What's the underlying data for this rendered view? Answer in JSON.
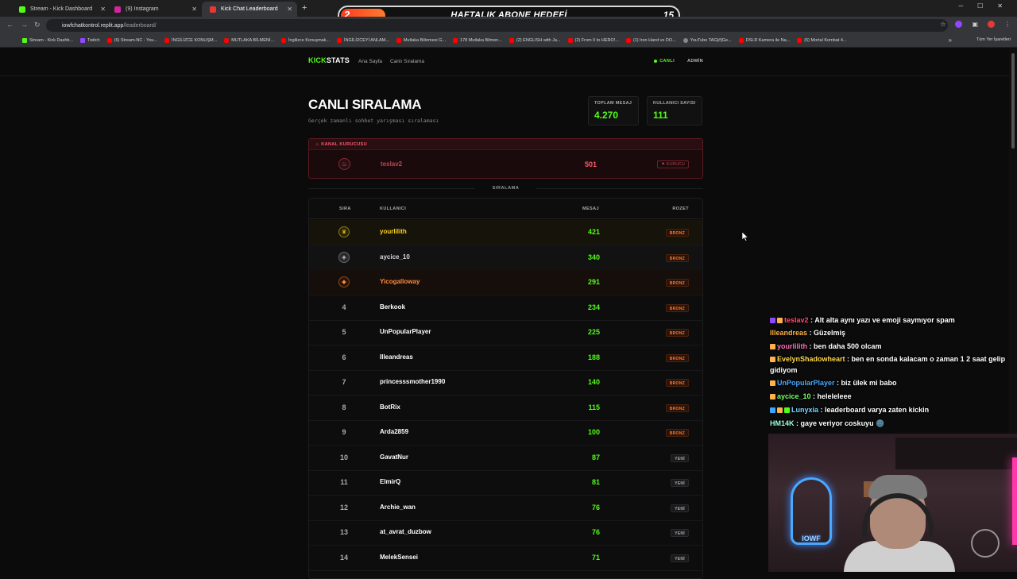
{
  "browser": {
    "tabs": [
      {
        "label": "Stream - Kick Dashboard",
        "color": "#53fc18"
      },
      {
        "label": "(9) Instagram",
        "color": "#d6249f"
      },
      {
        "label": "Kick Chat Leaderboard",
        "color": "#e53935"
      }
    ],
    "url_host": "iowfchatkontrol.replit.app",
    "url_path": "/leaderboard/",
    "bookmarks": [
      {
        "label": "Stream - Kick Dashb...",
        "icon": "k"
      },
      {
        "label": "Twitch",
        "icon": "tw"
      },
      {
        "label": "(6) Stream-NC - You...",
        "icon": "yt"
      },
      {
        "label": "İNGİLİZCE KONUŞM...",
        "icon": "yt"
      },
      {
        "label": "MUTLAKA BİLMENİ...",
        "icon": "yt"
      },
      {
        "label": "İngilizce Konuşmak...",
        "icon": "yt"
      },
      {
        "label": "İNGİLİZCEYİ ANLAM...",
        "icon": "yt"
      },
      {
        "label": "Mutlaka Bilinmesi G...",
        "icon": "yt"
      },
      {
        "label": "178 Mutlaka Bilmen...",
        "icon": "yt"
      },
      {
        "label": "(2) ENGLISH with Ja...",
        "icon": "yt"
      },
      {
        "label": "(2) From 0 to HERO!...",
        "icon": "yt"
      },
      {
        "label": "(1) Iron Hand vs DO...",
        "icon": "yt"
      },
      {
        "label": "YouTube TAG[#]Ge...",
        "icon": "g"
      },
      {
        "label": "DSLR Kamera ile Na...",
        "icon": "yt"
      },
      {
        "label": "(5) Mortal Kombat 4...",
        "icon": "yt"
      }
    ],
    "bookmarks_right": "Tüm Yer İşaretleri"
  },
  "goal": {
    "current": "2",
    "label": "HAFTALIK ABONE HEDEFİ",
    "target": "15",
    "progress": 0.13
  },
  "nav": {
    "logo_a": "KICK",
    "logo_b": "STATS",
    "links": [
      "Ana Sayfa",
      "Canlı Sıralama"
    ],
    "live": "CANLI",
    "admin": "ADMİN"
  },
  "header": {
    "title": "CANLI SIRALAMA",
    "subtitle": "Gerçek zamanlı sohbet yarışması sıralaması"
  },
  "stats": [
    {
      "label": "TOPLAM MESAJ",
      "value": "4.270"
    },
    {
      "label": "KULLANICI SAYISI",
      "value": "111"
    }
  ],
  "founder": {
    "header": "KANAL KURUCUSU",
    "name": "teslav2",
    "count": "501",
    "badge": "KURUCU"
  },
  "section_title": "SIRALAMA",
  "table": {
    "headers": {
      "rank": "SIRA",
      "user": "KULLANICI",
      "messages": "MESAJ",
      "badge": "ROZET"
    },
    "rows": [
      {
        "rank": "1",
        "medal": "g",
        "name": "yourlilith",
        "count": "421",
        "badge": "BRONZ"
      },
      {
        "rank": "2",
        "medal": "s",
        "name": "aycice_10",
        "count": "340",
        "badge": "BRONZ"
      },
      {
        "rank": "3",
        "medal": "b",
        "name": "Yicogalloway",
        "count": "291",
        "badge": "BRONZ"
      },
      {
        "rank": "4",
        "medal": "",
        "name": "Berkook",
        "count": "234",
        "badge": "BRONZ"
      },
      {
        "rank": "5",
        "medal": "",
        "name": "UnPopularPlayer",
        "count": "225",
        "badge": "BRONZ"
      },
      {
        "rank": "6",
        "medal": "",
        "name": "Illeandreas",
        "count": "188",
        "badge": "BRONZ"
      },
      {
        "rank": "7",
        "medal": "",
        "name": "princesssmother1990",
        "count": "140",
        "badge": "BRONZ"
      },
      {
        "rank": "8",
        "medal": "",
        "name": "BotRix",
        "count": "115",
        "badge": "BRONZ"
      },
      {
        "rank": "9",
        "medal": "",
        "name": "Arda2859",
        "count": "100",
        "badge": "BRONZ"
      },
      {
        "rank": "10",
        "medal": "",
        "name": "GavatNur",
        "count": "87",
        "badge": "YENİ"
      },
      {
        "rank": "11",
        "medal": "",
        "name": "ElmirQ",
        "count": "81",
        "badge": "YENİ"
      },
      {
        "rank": "12",
        "medal": "",
        "name": "Archie_wan",
        "count": "76",
        "badge": "YENİ"
      },
      {
        "rank": "13",
        "medal": "",
        "name": "at_avrat_duzbow",
        "count": "76",
        "badge": "YENİ"
      },
      {
        "rank": "14",
        "medal": "",
        "name": "MelekSensei",
        "count": "71",
        "badge": "YENİ"
      }
    ]
  },
  "chat": [
    {
      "user": "teslav2",
      "color": "#ff4d6a",
      "icons": [
        "#9146ff",
        "#ffb14d"
      ],
      "text": "Alt alta aynı yazı ve emoji saymıyor spam"
    },
    {
      "user": "Illeandreas",
      "color": "#ffb347",
      "icons": [],
      "text": "Güzelmiş"
    },
    {
      "user": "yourlilith",
      "color": "#ff6fb5",
      "icons": [
        "#ffb14d"
      ],
      "text": "ben daha 500 olcam"
    },
    {
      "user": "EvelynShadowheart",
      "color": "#ffd94d",
      "icons": [
        "#ffb14d"
      ],
      "text": "ben en sonda kalacam o zaman 1 2 saat gelip gidiyom"
    },
    {
      "user": "UnPopularPlayer",
      "color": "#4aa8ff",
      "icons": [
        "#ffb14d"
      ],
      "text": "biz ülek mi babo"
    },
    {
      "user": "aycice_10",
      "color": "#7dff6a",
      "icons": [
        "#ffb14d"
      ],
      "text": "heleleleee"
    },
    {
      "user": "Lunyxia",
      "color": "#7ad7ff",
      "icons": [
        "#3aa8ff",
        "#ffb14d",
        "#53fc18"
      ],
      "text": "leaderboard varya zaten kickin"
    },
    {
      "user": "HM14K",
      "color": "#9fffe0",
      "icons": [],
      "text": "gaye veriyor coskuyu 🌚"
    }
  ],
  "webcam": {
    "neon_text": "IOWF"
  }
}
